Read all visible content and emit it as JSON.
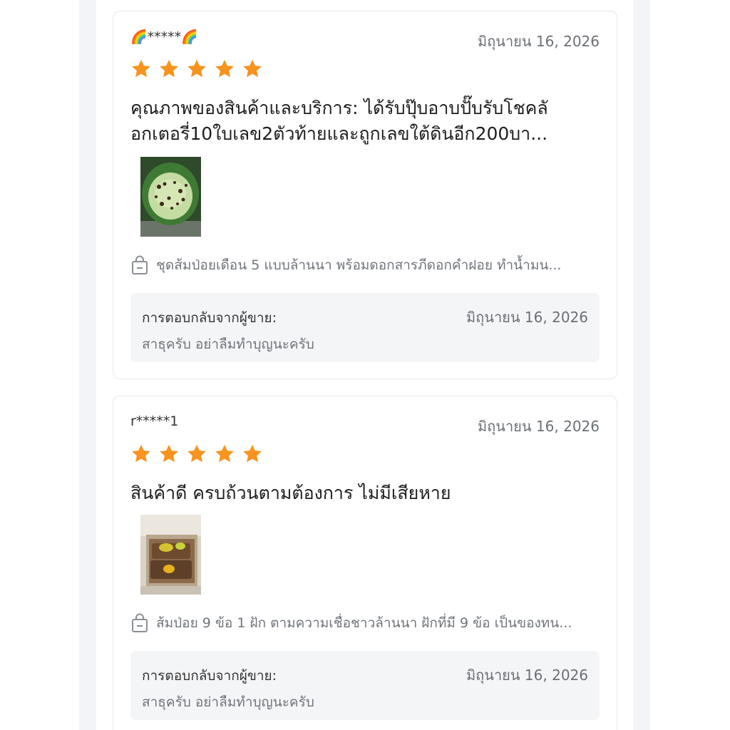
{
  "reviews": [
    {
      "username": "🌈*****🌈",
      "date": "มิถุนายน 16, 2026",
      "rating": 5,
      "text_lines": [
        "คุณภาพของสินค้าและบริการ: ได้รับปุ๊บอาบปั๊บรับโชคลั",
        "อกเตอรี่10ใบเลข2ตัวท้ายและถูกเลขใต้ดินอีก200บา..."
      ],
      "photo_icon": "photo-thumbnail-icon",
      "product_icon": "shopping-bag-icon",
      "product": "ชุดส้มป่อยเดือน 5 แบบล้านนา พร้อมดอกสารภีดอกคำฝอย ทำน้ำมน...",
      "seller_reply": {
        "label": "การตอบกลับจากผู้ขาย:",
        "date": "มิถุนายน 16, 2026",
        "text": "สาธุครับ อย่าลืมทำบุญนะครับ"
      }
    },
    {
      "username": "r*****1",
      "date": "มิถุนายน 16, 2026",
      "rating": 5,
      "text_lines": [
        "สินค้าดี ครบถ้วนตามต้องการ ไม่มีเสียหาย"
      ],
      "photo_icon": "photo-thumbnail-icon",
      "product_icon": "shopping-bag-icon",
      "product": "ส้มป่อย 9 ข้อ 1 ฝัก ตามความเชื่อชาวล้านนา ฝักที่มี 9 ข้อ เป็นของทน...",
      "seller_reply": {
        "label": "การตอบกลับจากผู้ขาย:",
        "date": "มิถุนายน 16, 2026",
        "text": "สาธุครับ อย่าลืมทำบุญนะครับ"
      }
    }
  ],
  "colors": {
    "star": "#f7931e",
    "page_gutter": "#f2f4f7",
    "reply_background": "#f4f5f7",
    "muted_text": "#70757c"
  }
}
